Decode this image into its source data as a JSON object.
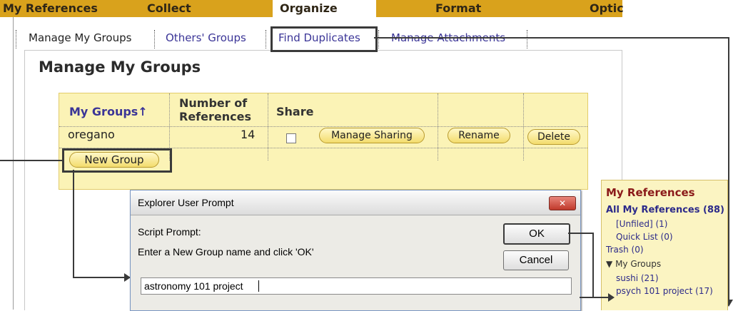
{
  "top_tabs": [
    "My References",
    "Collect",
    "Organize",
    "Format",
    "Optic"
  ],
  "sub_tabs": [
    "Manage My Groups",
    "Others' Groups",
    "Find Duplicates",
    "Manage Attachments"
  ],
  "page_title": "Manage My Groups",
  "table": {
    "header_groups": "My Groups",
    "header_groups_arrow": "↑",
    "header_number_line1": "Number of",
    "header_number_line2": "References",
    "header_share": "Share",
    "rows": [
      {
        "name": "oregano",
        "count": "14",
        "manage_sharing": "Manage Sharing",
        "rename": "Rename",
        "delete": "Delete"
      }
    ],
    "new_group_label": "New Group"
  },
  "dialog": {
    "title": "Explorer User Prompt",
    "close_glyph": "✕",
    "script_prompt": "Script Prompt:",
    "message": "Enter a New Group name and click 'OK'",
    "ok": "OK",
    "cancel": "Cancel",
    "input_value": "astronomy 101 project"
  },
  "sidebar": {
    "heading": "My References",
    "all_refs": "All My References (88)",
    "items": [
      "[Unfiled] (1)",
      "Quick List (0)"
    ],
    "trash": "Trash (0)",
    "groups_arrow": "▼",
    "groups_label": "My Groups",
    "group_items": [
      "sushi  (21)",
      "psych 101 project  (17)"
    ]
  },
  "colors": {
    "tab_bar": "#d9a21c",
    "table_bg": "#fbf3b6",
    "link": "#3b3597",
    "sidebar_heading": "#8b1a1a"
  }
}
